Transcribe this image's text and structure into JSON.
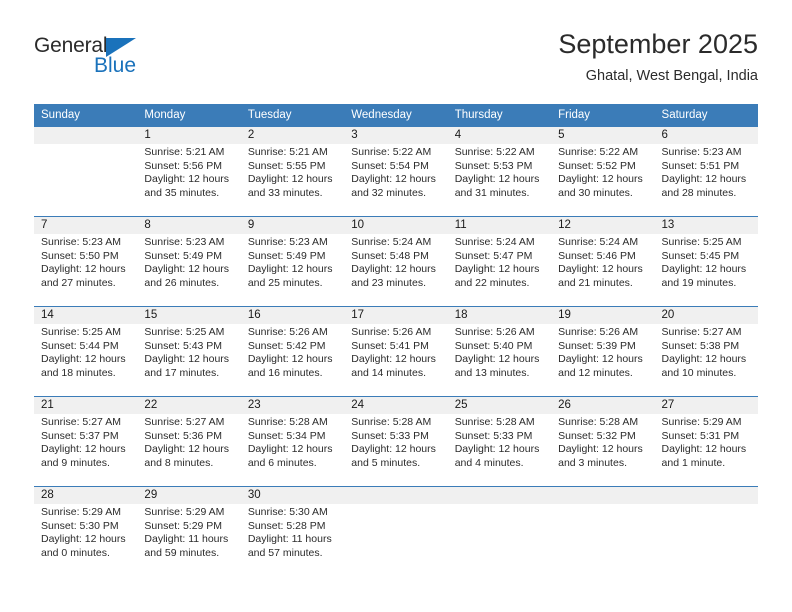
{
  "brand": {
    "line1": "General",
    "line2": "Blue",
    "triangle_color": "#1a72bb",
    "text_color": "#2b2b2b"
  },
  "header": {
    "title": "September 2025",
    "subtitle": "Ghatal, West Bengal, India"
  },
  "theme": {
    "header_bg": "#3b7cb8",
    "header_text": "#ffffff",
    "band_bg": "#f0f0f0",
    "cell_bg": "#ffffff",
    "rule_color": "#3b7cb8"
  },
  "weekday_headers": [
    "Sunday",
    "Monday",
    "Tuesday",
    "Wednesday",
    "Thursday",
    "Friday",
    "Saturday"
  ],
  "weeks": [
    {
      "numbers": [
        "",
        "1",
        "2",
        "3",
        "4",
        "5",
        "6"
      ],
      "cells": [
        {
          "sunrise": "",
          "sunset": "",
          "daylight_1": "",
          "daylight_2": ""
        },
        {
          "sunrise": "Sunrise: 5:21 AM",
          "sunset": "Sunset: 5:56 PM",
          "daylight_1": "Daylight: 12 hours",
          "daylight_2": "and 35 minutes."
        },
        {
          "sunrise": "Sunrise: 5:21 AM",
          "sunset": "Sunset: 5:55 PM",
          "daylight_1": "Daylight: 12 hours",
          "daylight_2": "and 33 minutes."
        },
        {
          "sunrise": "Sunrise: 5:22 AM",
          "sunset": "Sunset: 5:54 PM",
          "daylight_1": "Daylight: 12 hours",
          "daylight_2": "and 32 minutes."
        },
        {
          "sunrise": "Sunrise: 5:22 AM",
          "sunset": "Sunset: 5:53 PM",
          "daylight_1": "Daylight: 12 hours",
          "daylight_2": "and 31 minutes."
        },
        {
          "sunrise": "Sunrise: 5:22 AM",
          "sunset": "Sunset: 5:52 PM",
          "daylight_1": "Daylight: 12 hours",
          "daylight_2": "and 30 minutes."
        },
        {
          "sunrise": "Sunrise: 5:23 AM",
          "sunset": "Sunset: 5:51 PM",
          "daylight_1": "Daylight: 12 hours",
          "daylight_2": "and 28 minutes."
        }
      ]
    },
    {
      "numbers": [
        "7",
        "8",
        "9",
        "10",
        "11",
        "12",
        "13"
      ],
      "cells": [
        {
          "sunrise": "Sunrise: 5:23 AM",
          "sunset": "Sunset: 5:50 PM",
          "daylight_1": "Daylight: 12 hours",
          "daylight_2": "and 27 minutes."
        },
        {
          "sunrise": "Sunrise: 5:23 AM",
          "sunset": "Sunset: 5:49 PM",
          "daylight_1": "Daylight: 12 hours",
          "daylight_2": "and 26 minutes."
        },
        {
          "sunrise": "Sunrise: 5:23 AM",
          "sunset": "Sunset: 5:49 PM",
          "daylight_1": "Daylight: 12 hours",
          "daylight_2": "and 25 minutes."
        },
        {
          "sunrise": "Sunrise: 5:24 AM",
          "sunset": "Sunset: 5:48 PM",
          "daylight_1": "Daylight: 12 hours",
          "daylight_2": "and 23 minutes."
        },
        {
          "sunrise": "Sunrise: 5:24 AM",
          "sunset": "Sunset: 5:47 PM",
          "daylight_1": "Daylight: 12 hours",
          "daylight_2": "and 22 minutes."
        },
        {
          "sunrise": "Sunrise: 5:24 AM",
          "sunset": "Sunset: 5:46 PM",
          "daylight_1": "Daylight: 12 hours",
          "daylight_2": "and 21 minutes."
        },
        {
          "sunrise": "Sunrise: 5:25 AM",
          "sunset": "Sunset: 5:45 PM",
          "daylight_1": "Daylight: 12 hours",
          "daylight_2": "and 19 minutes."
        }
      ]
    },
    {
      "numbers": [
        "14",
        "15",
        "16",
        "17",
        "18",
        "19",
        "20"
      ],
      "cells": [
        {
          "sunrise": "Sunrise: 5:25 AM",
          "sunset": "Sunset: 5:44 PM",
          "daylight_1": "Daylight: 12 hours",
          "daylight_2": "and 18 minutes."
        },
        {
          "sunrise": "Sunrise: 5:25 AM",
          "sunset": "Sunset: 5:43 PM",
          "daylight_1": "Daylight: 12 hours",
          "daylight_2": "and 17 minutes."
        },
        {
          "sunrise": "Sunrise: 5:26 AM",
          "sunset": "Sunset: 5:42 PM",
          "daylight_1": "Daylight: 12 hours",
          "daylight_2": "and 16 minutes."
        },
        {
          "sunrise": "Sunrise: 5:26 AM",
          "sunset": "Sunset: 5:41 PM",
          "daylight_1": "Daylight: 12 hours",
          "daylight_2": "and 14 minutes."
        },
        {
          "sunrise": "Sunrise: 5:26 AM",
          "sunset": "Sunset: 5:40 PM",
          "daylight_1": "Daylight: 12 hours",
          "daylight_2": "and 13 minutes."
        },
        {
          "sunrise": "Sunrise: 5:26 AM",
          "sunset": "Sunset: 5:39 PM",
          "daylight_1": "Daylight: 12 hours",
          "daylight_2": "and 12 minutes."
        },
        {
          "sunrise": "Sunrise: 5:27 AM",
          "sunset": "Sunset: 5:38 PM",
          "daylight_1": "Daylight: 12 hours",
          "daylight_2": "and 10 minutes."
        }
      ]
    },
    {
      "numbers": [
        "21",
        "22",
        "23",
        "24",
        "25",
        "26",
        "27"
      ],
      "cells": [
        {
          "sunrise": "Sunrise: 5:27 AM",
          "sunset": "Sunset: 5:37 PM",
          "daylight_1": "Daylight: 12 hours",
          "daylight_2": "and 9 minutes."
        },
        {
          "sunrise": "Sunrise: 5:27 AM",
          "sunset": "Sunset: 5:36 PM",
          "daylight_1": "Daylight: 12 hours",
          "daylight_2": "and 8 minutes."
        },
        {
          "sunrise": "Sunrise: 5:28 AM",
          "sunset": "Sunset: 5:34 PM",
          "daylight_1": "Daylight: 12 hours",
          "daylight_2": "and 6 minutes."
        },
        {
          "sunrise": "Sunrise: 5:28 AM",
          "sunset": "Sunset: 5:33 PM",
          "daylight_1": "Daylight: 12 hours",
          "daylight_2": "and 5 minutes."
        },
        {
          "sunrise": "Sunrise: 5:28 AM",
          "sunset": "Sunset: 5:33 PM",
          "daylight_1": "Daylight: 12 hours",
          "daylight_2": "and 4 minutes."
        },
        {
          "sunrise": "Sunrise: 5:28 AM",
          "sunset": "Sunset: 5:32 PM",
          "daylight_1": "Daylight: 12 hours",
          "daylight_2": "and 3 minutes."
        },
        {
          "sunrise": "Sunrise: 5:29 AM",
          "sunset": "Sunset: 5:31 PM",
          "daylight_1": "Daylight: 12 hours",
          "daylight_2": "and 1 minute."
        }
      ]
    },
    {
      "numbers": [
        "28",
        "29",
        "30",
        "",
        "",
        "",
        ""
      ],
      "cells": [
        {
          "sunrise": "Sunrise: 5:29 AM",
          "sunset": "Sunset: 5:30 PM",
          "daylight_1": "Daylight: 12 hours",
          "daylight_2": "and 0 minutes."
        },
        {
          "sunrise": "Sunrise: 5:29 AM",
          "sunset": "Sunset: 5:29 PM",
          "daylight_1": "Daylight: 11 hours",
          "daylight_2": "and 59 minutes."
        },
        {
          "sunrise": "Sunrise: 5:30 AM",
          "sunset": "Sunset: 5:28 PM",
          "daylight_1": "Daylight: 11 hours",
          "daylight_2": "and 57 minutes."
        },
        {
          "sunrise": "",
          "sunset": "",
          "daylight_1": "",
          "daylight_2": ""
        },
        {
          "sunrise": "",
          "sunset": "",
          "daylight_1": "",
          "daylight_2": ""
        },
        {
          "sunrise": "",
          "sunset": "",
          "daylight_1": "",
          "daylight_2": ""
        },
        {
          "sunrise": "",
          "sunset": "",
          "daylight_1": "",
          "daylight_2": ""
        }
      ]
    }
  ]
}
